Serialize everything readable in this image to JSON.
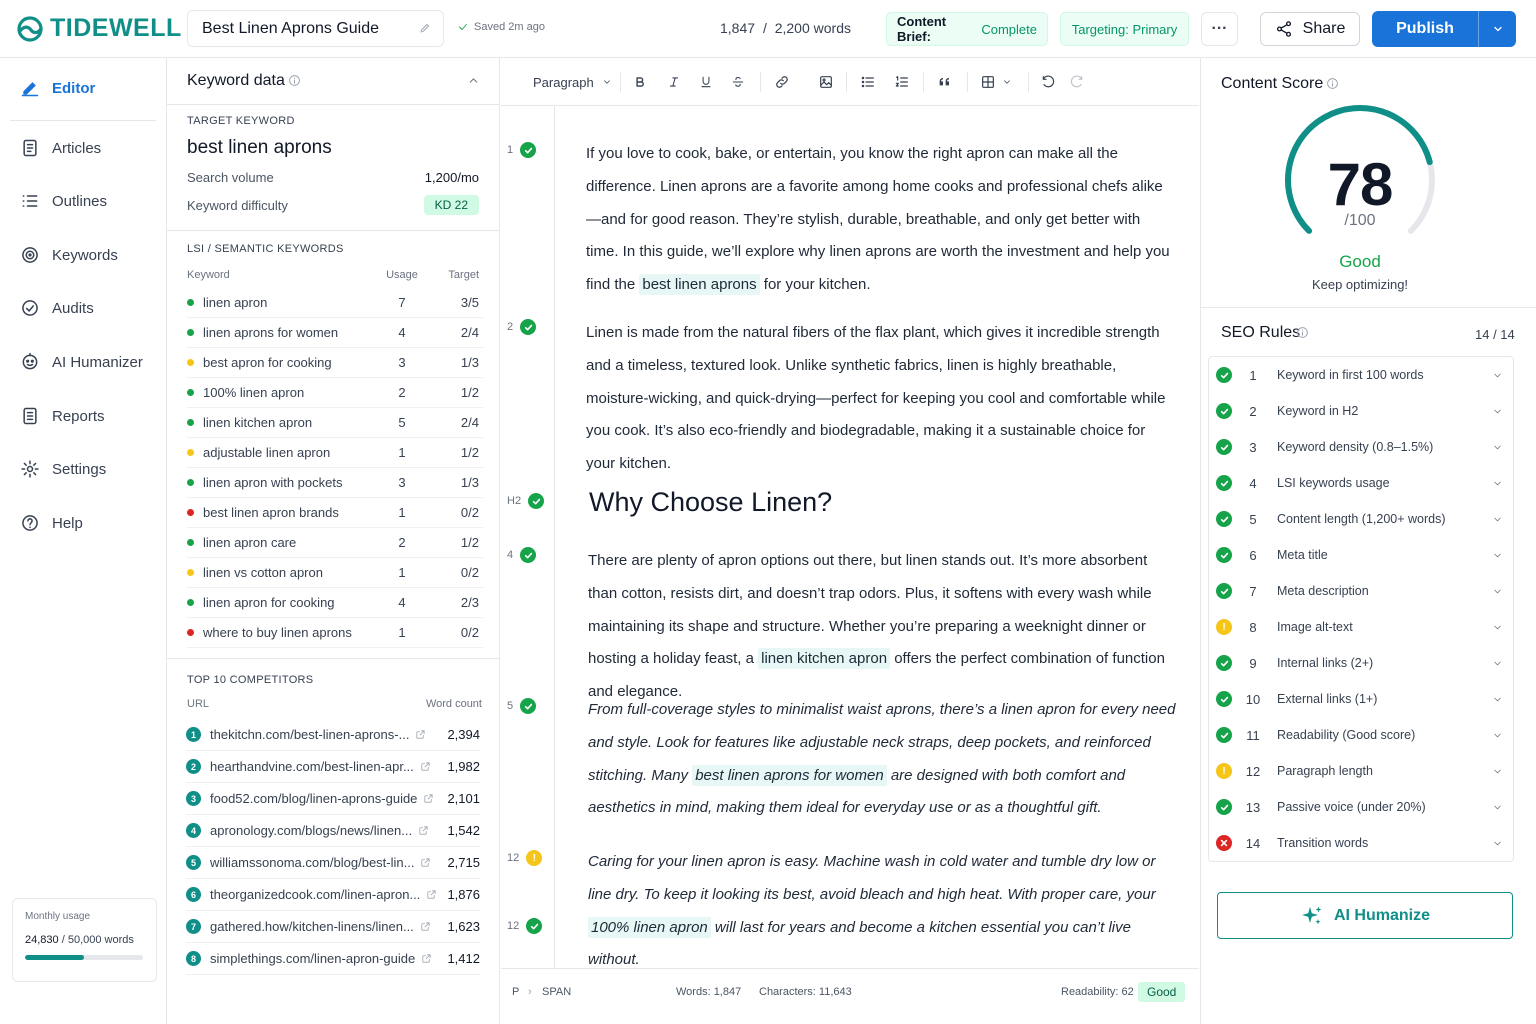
{
  "brand": {
    "name": "TIDEWELL",
    "accent": "#0f8f87",
    "primary": "#1a73d9",
    "success": "#16a34a",
    "warning": "#f5c518",
    "error": "#dc2626"
  },
  "header": {
    "doc_title": "Best Linen Aprons Guide",
    "saved": "Saved 2m ago",
    "words_current": "1,847",
    "words_sep": "/",
    "words_target": "2,200 words",
    "brief_label": "Content Brief:",
    "brief_value": "Complete",
    "targeting": "Targeting: Primary",
    "more": "···",
    "share": "Share",
    "publish": "Publish"
  },
  "sidebar": {
    "items": [
      {
        "label": "Editor",
        "icon": "edit-icon",
        "active": true
      },
      {
        "label": "Articles",
        "icon": "document-icon"
      },
      {
        "label": "Outlines",
        "icon": "list-icon"
      },
      {
        "label": "Keywords",
        "icon": "target-icon"
      },
      {
        "label": "Audits",
        "icon": "check-circle-icon"
      },
      {
        "label": "AI Humanizer",
        "icon": "robot-icon"
      },
      {
        "label": "Reports",
        "icon": "report-icon"
      },
      {
        "label": "Settings",
        "icon": "gear-icon"
      },
      {
        "label": "Help",
        "icon": "help-icon"
      }
    ],
    "usage": {
      "title": "Monthly usage",
      "used": "24,830",
      "limit": "/ 50,000 words",
      "fraction": 0.4966
    }
  },
  "keyword_panel": {
    "title": "Keyword data",
    "target_label": "TARGET KEYWORD",
    "target_keyword": "best linen aprons",
    "search_volume_label": "Search volume",
    "search_volume": "1,200/mo",
    "difficulty_label": "Keyword difficulty",
    "difficulty": "KD 22",
    "lsi_label": "LSI / SEMANTIC KEYWORDS",
    "lsi_cols": {
      "keyword": "Keyword",
      "usage": "Usage",
      "target": "Target"
    },
    "lsi": [
      {
        "kw": "linen apron",
        "usage": "7",
        "target": "3/5",
        "status": "green"
      },
      {
        "kw": "linen aprons for women",
        "usage": "4",
        "target": "2/4",
        "status": "green"
      },
      {
        "kw": "best apron for cooking",
        "usage": "3",
        "target": "1/3",
        "status": "yellow"
      },
      {
        "kw": "100% linen apron",
        "usage": "2",
        "target": "1/2",
        "status": "green"
      },
      {
        "kw": "linen kitchen apron",
        "usage": "5",
        "target": "2/4",
        "status": "green"
      },
      {
        "kw": "adjustable linen apron",
        "usage": "1",
        "target": "1/2",
        "status": "yellow"
      },
      {
        "kw": "linen apron with pockets",
        "usage": "3",
        "target": "1/3",
        "status": "green"
      },
      {
        "kw": "best linen apron brands",
        "usage": "1",
        "target": "0/2",
        "status": "red"
      },
      {
        "kw": "linen apron care",
        "usage": "2",
        "target": "1/2",
        "status": "green"
      },
      {
        "kw": "linen vs cotton apron",
        "usage": "1",
        "target": "0/2",
        "status": "yellow"
      },
      {
        "kw": "linen apron for cooking",
        "usage": "4",
        "target": "2/3",
        "status": "green"
      },
      {
        "kw": "where to buy linen aprons",
        "usage": "1",
        "target": "0/2",
        "status": "red"
      }
    ],
    "competitors_label": "TOP 10 COMPETITORS",
    "comp_cols": {
      "url": "URL",
      "wc": "Word count"
    },
    "competitors": [
      {
        "n": "1",
        "url": "thekitchn.com/best-linen-aprons-...",
        "wc": "2,394"
      },
      {
        "n": "2",
        "url": "hearthandvine.com/best-linen-apr...",
        "wc": "1,982"
      },
      {
        "n": "3",
        "url": "food52.com/blog/linen-aprons-guide",
        "wc": "2,101"
      },
      {
        "n": "4",
        "url": "apronology.com/blogs/news/linen...",
        "wc": "1,542"
      },
      {
        "n": "5",
        "url": "williamssonoma.com/blog/best-lin...",
        "wc": "2,715"
      },
      {
        "n": "6",
        "url": "theorganizedcook.com/linen-apron...",
        "wc": "1,876"
      },
      {
        "n": "7",
        "url": "gathered.how/kitchen-linens/linen...",
        "wc": "1,623"
      },
      {
        "n": "8",
        "url": "simplethings.com/linen-apron-guide",
        "wc": "1,412"
      }
    ]
  },
  "editor": {
    "block_type": "Paragraph",
    "gutter": [
      {
        "label": "1",
        "status": "ok"
      },
      {
        "label": "2",
        "status": "ok"
      },
      {
        "label": "H2",
        "status": "ok"
      },
      {
        "label": "4",
        "status": "ok"
      },
      {
        "label": "5",
        "status": "ok"
      },
      {
        "label": "12",
        "status": "warn"
      },
      {
        "label": "12",
        "status": "ok"
      }
    ],
    "p1": {
      "a": "If you love to cook, bake, or entertain, you know the right apron can make all the difference. Linen aprons are a favorite among home cooks and professional chefs alike—and for good reason. They’re stylish, durable, breathable, and only get better with time. In this guide, we’ll explore why linen aprons are worth the investment and help you find the ",
      "hl": "best linen aprons",
      "b": " for your kitchen."
    },
    "p2": "Linen is made from the natural fibers of the flax plant, which gives it incredible strength and a timeless, textured look. Unlike synthetic fabrics, linen is highly breathable, moisture-wicking, and quick-drying—perfect for keeping you cool and comfortable while you cook. It’s also eco-friendly and biodegradable, making it a sustainable choice for your kitchen.",
    "h2": "Why Choose Linen?",
    "p3": {
      "a": "There are plenty of apron options out there, but linen stands out. It’s more absorbent than cotton, resists dirt, and doesn’t trap odors. Plus, it softens with every wash while maintaining its shape and structure. Whether you’re preparing a weeknight dinner or hosting a holiday feast, a ",
      "hl": "linen kitchen apron",
      "b": " offers the perfect combination of function and elegance."
    },
    "p4": {
      "a": "From full-coverage styles to minimalist waist aprons, there’s a linen apron for every need and style. Look for features like adjustable neck straps, deep pockets, and reinforced stitching. Many ",
      "hl": "best linen aprons for women",
      "b": " are designed with both comfort and aesthetics in mind, making them ideal for everyday use or as a thoughtful gift."
    },
    "p5": {
      "a": "Caring for your linen apron is easy. Machine wash in cold water and tumble dry low or line dry. To keep it looking its best, avoid bleach and high heat. With proper care, your ",
      "hl": "100% linen apron",
      "b": " will last for years and become a kitchen essential you can’t live without."
    },
    "status": {
      "path_p": "P",
      "path_span": "SPAN",
      "words": "Words: 1,847",
      "chars": "Characters: 11,643",
      "readability": "Readability: 62",
      "read_tag": "Good"
    }
  },
  "score": {
    "title": "Content Score",
    "value": "78",
    "max": "/100",
    "fraction": 0.78,
    "label": "Good",
    "sub": "Keep optimizing!"
  },
  "seo": {
    "title": "SEO Rules",
    "count": "14 / 14",
    "rules": [
      {
        "n": "1",
        "label": "Keyword in first 100 words",
        "status": "ok"
      },
      {
        "n": "2",
        "label": "Keyword in H2",
        "status": "ok"
      },
      {
        "n": "3",
        "label": "Keyword density (0.8–1.5%)",
        "status": "ok"
      },
      {
        "n": "4",
        "label": "LSI keywords usage",
        "status": "ok"
      },
      {
        "n": "5",
        "label": "Content length (1,200+ words)",
        "status": "ok"
      },
      {
        "n": "6",
        "label": "Meta title",
        "status": "ok"
      },
      {
        "n": "7",
        "label": "Meta description",
        "status": "ok"
      },
      {
        "n": "8",
        "label": "Image alt-text",
        "status": "warn"
      },
      {
        "n": "9",
        "label": "Internal links (2+)",
        "status": "ok"
      },
      {
        "n": "10",
        "label": "External links (1+)",
        "status": "ok"
      },
      {
        "n": "11",
        "label": "Readability (Good score)",
        "status": "ok"
      },
      {
        "n": "12",
        "label": "Paragraph length",
        "status": "warn"
      },
      {
        "n": "13",
        "label": "Passive voice (under 20%)",
        "status": "ok"
      },
      {
        "n": "14",
        "label": "Transition words",
        "status": "error"
      }
    ],
    "humanize": "AI Humanize"
  }
}
